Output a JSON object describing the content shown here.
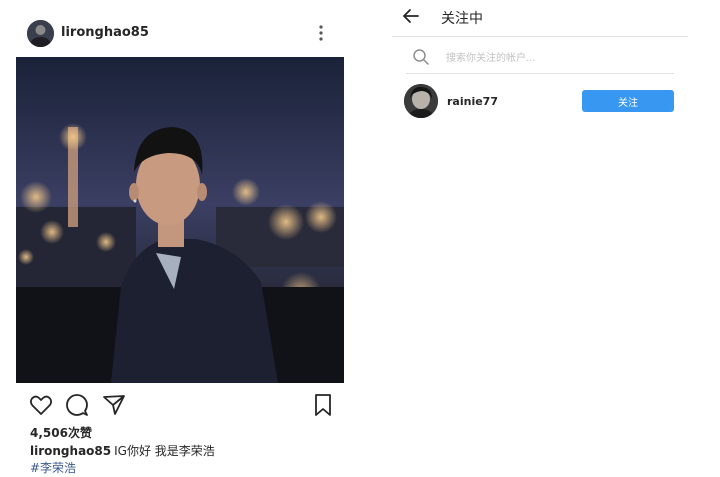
{
  "post": {
    "username": "lironghao85",
    "likes": "4,506次赞",
    "caption_user": "lironghao85",
    "caption_text": "IG你好 我是李荣浩",
    "hashtag": "#李荣浩",
    "icons": [
      "more-icon",
      "heart-icon",
      "comment-icon",
      "share-icon",
      "bookmark-icon"
    ]
  },
  "following": {
    "title": "关注中",
    "search_placeholder": "搜索你关注的帐户...",
    "users": [
      {
        "username": "rainie77",
        "button_label": "关注"
      }
    ],
    "icons": [
      "back-arrow-icon",
      "search-icon"
    ],
    "accent_color": "#3897f0"
  }
}
